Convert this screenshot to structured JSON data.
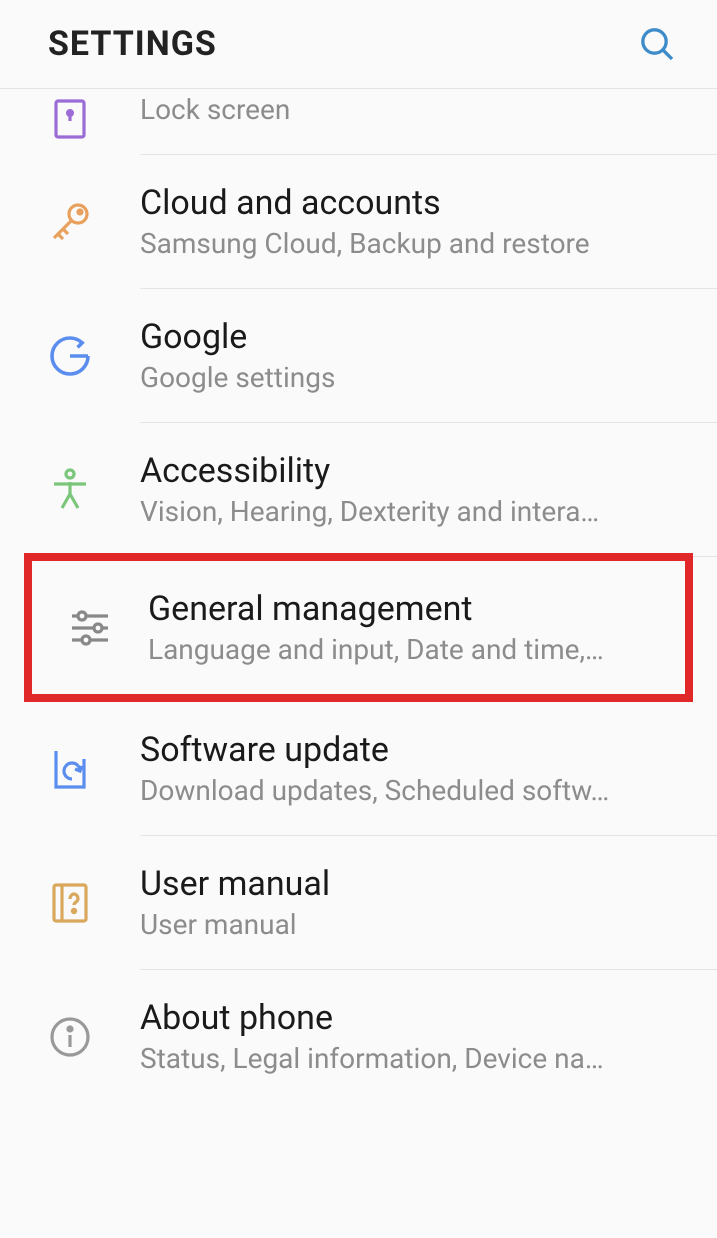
{
  "header": {
    "title": "SETTINGS"
  },
  "items": [
    {
      "title": "",
      "subtitle": "Lock screen",
      "icon": "lock",
      "highlighted": false,
      "partial": true
    },
    {
      "title": "Cloud and accounts",
      "subtitle": "Samsung Cloud, Backup and restore",
      "icon": "key",
      "highlighted": false
    },
    {
      "title": "Google",
      "subtitle": "Google settings",
      "icon": "google",
      "highlighted": false
    },
    {
      "title": "Accessibility",
      "subtitle": "Vision, Hearing, Dexterity and intera…",
      "icon": "person",
      "highlighted": false
    },
    {
      "title": "General management",
      "subtitle": "Language and input, Date and time,…",
      "icon": "sliders",
      "highlighted": true
    },
    {
      "title": "Software update",
      "subtitle": "Download updates, Scheduled softw…",
      "icon": "update",
      "highlighted": false
    },
    {
      "title": "User manual",
      "subtitle": "User manual",
      "icon": "manual",
      "highlighted": false
    },
    {
      "title": "About phone",
      "subtitle": "Status, Legal information, Device na…",
      "icon": "info",
      "highlighted": false
    }
  ],
  "icon_colors": {
    "lock": "#9b6bd6",
    "key": "#e8a05c",
    "google": "#5b8def",
    "person": "#7bc67b",
    "sliders": "#888888",
    "update": "#5b8def",
    "manual": "#d9a85c",
    "info": "#999999"
  }
}
